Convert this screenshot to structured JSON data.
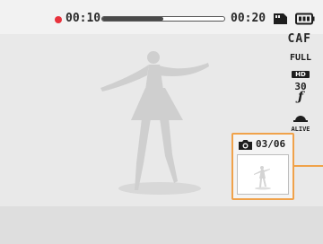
{
  "recording": {
    "indicator_color": "#e8323c",
    "elapsed": "00:10",
    "total": "00:20",
    "progress": 0.5
  },
  "status_icons": {
    "memory": "memory-card-icon",
    "battery": "battery-icon"
  },
  "focus_mode": "CAF",
  "settings": {
    "resolution_top": "FULL",
    "resolution_badge": "HD",
    "frame_rate": "30",
    "frame_rate_glyph": "ƒ",
    "alive_label": "ALIVE"
  },
  "capture": {
    "icon": "camera-icon",
    "count": "03/06",
    "accent_color": "#f0a24a"
  },
  "subject": {
    "icon": "dancer-silhouette-icon"
  }
}
